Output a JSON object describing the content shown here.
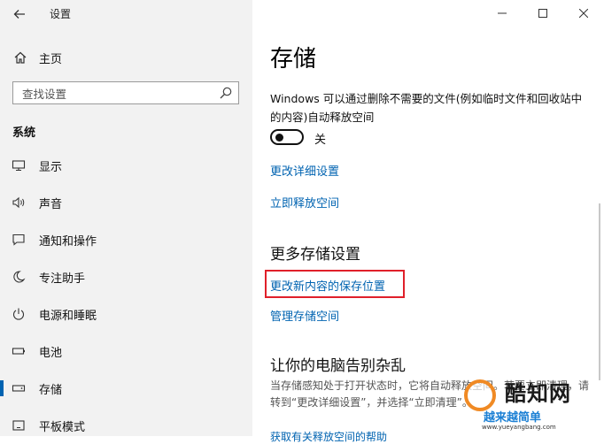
{
  "window": {
    "title": "设置",
    "controls": [
      "—",
      "☐",
      "✕"
    ]
  },
  "sidebar": {
    "home_label": "主页",
    "search_placeholder": "查找设置",
    "section_label": "系统",
    "items": [
      {
        "label": "显示",
        "icon": "monitor-icon"
      },
      {
        "label": "声音",
        "icon": "speaker-icon"
      },
      {
        "label": "通知和操作",
        "icon": "notification-icon"
      },
      {
        "label": "专注助手",
        "icon": "moon-icon"
      },
      {
        "label": "电源和睡眠",
        "icon": "power-icon"
      },
      {
        "label": "电池",
        "icon": "battery-icon"
      },
      {
        "label": "存储",
        "icon": "storage-icon",
        "active": true
      },
      {
        "label": "平板模式",
        "icon": "tablet-icon"
      }
    ]
  },
  "main": {
    "title": "存储",
    "description": "Windows 可以通过删除不需要的文件(例如临时文件和回收站中的内容)自动释放空间",
    "toggle": {
      "state": "off",
      "label": "关"
    },
    "link_change_settings": "更改详细设置",
    "link_free_space": "立即释放空间",
    "more_heading": "更多存储设置",
    "link_change_save_location": "更改新内容的保存位置",
    "link_manage_spaces": "管理存储空间",
    "declutter_heading": "让你的电脑告别杂乱",
    "declutter_text": "当存储感知处于打开状态时，它将自动释放空间。若要立即清理，请转到“更改详细设置”，并选择“立即清理”。",
    "link_more_help": "获取有关释放空间的帮助"
  },
  "watermark": {
    "title": "酷知网",
    "subtitle": "越来越简单",
    "url": "www.yueyangbang.com"
  },
  "colors": {
    "accent": "#0063b1",
    "highlight": "#e0202a",
    "sidebar_bg": "#f2f2f2"
  }
}
